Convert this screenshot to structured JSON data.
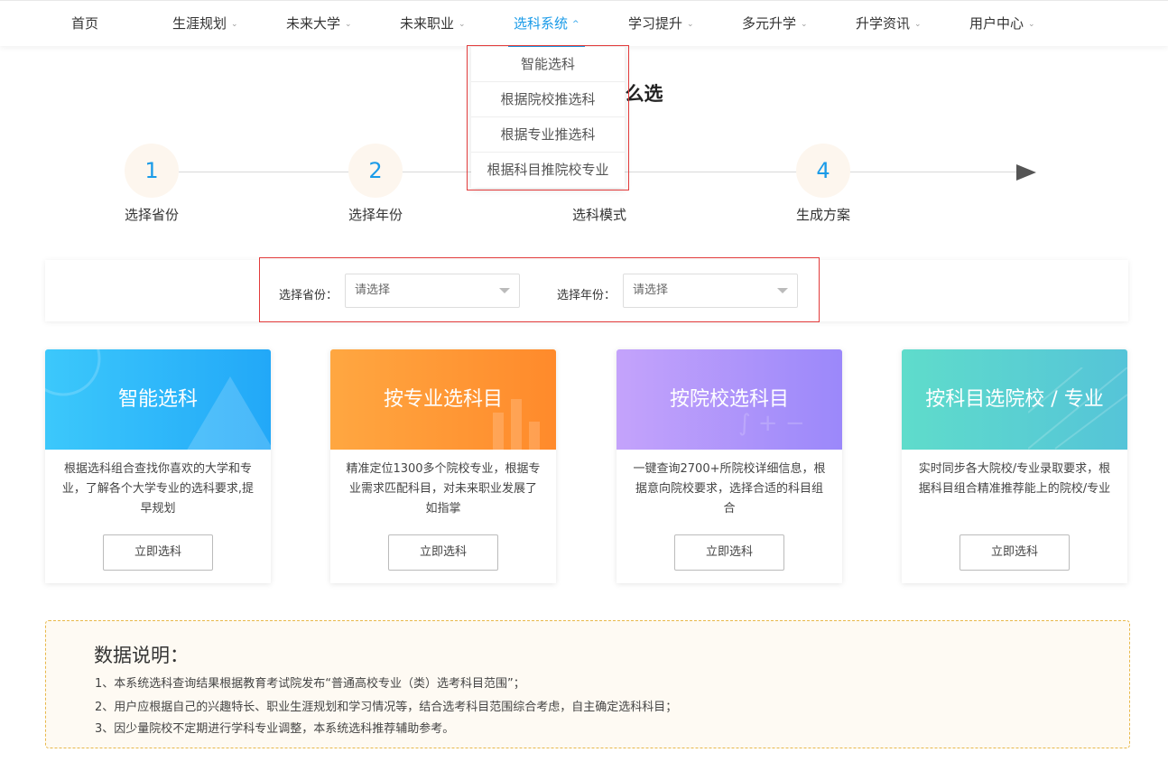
{
  "nav": {
    "items": [
      {
        "label": "首页",
        "has_chevron": false
      },
      {
        "label": "生涯规划",
        "has_chevron": true
      },
      {
        "label": "未来大学",
        "has_chevron": true
      },
      {
        "label": "未来职业",
        "has_chevron": true
      },
      {
        "label": "选科系统",
        "has_chevron": true,
        "active": true
      },
      {
        "label": "学习提升",
        "has_chevron": true
      },
      {
        "label": "多元升学",
        "has_chevron": true
      },
      {
        "label": "升学资讯",
        "has_chevron": true
      },
      {
        "label": "用户中心",
        "has_chevron": true
      }
    ],
    "chevron_down": "⌄",
    "chevron_up": "^"
  },
  "dropdown": {
    "items": [
      "智能选科",
      "根据院校推选科",
      "根据专业推选科",
      "根据科目推院校专业"
    ]
  },
  "heading": "么选",
  "steps": [
    {
      "number": "1",
      "label": "选择省份"
    },
    {
      "number": "2",
      "label": "选择年份"
    },
    {
      "number": "",
      "label": "选科模式"
    },
    {
      "number": "4",
      "label": "生成方案"
    }
  ],
  "selectors": {
    "province_label": "选择省份：",
    "province_value": "请选择",
    "year_label": "选择年份：",
    "year_value": "请选择"
  },
  "cards": [
    {
      "title": "智能选科",
      "desc": "根据选科组合查找你喜欢的大学和专业，了解各个大学专业的选科要求,提早规划",
      "button": "立即选科"
    },
    {
      "title": "按专业选科目",
      "desc": "精准定位1300多个院校专业，根据专业需求匹配科目，对未来职业发展了如指掌",
      "button": "立即选科"
    },
    {
      "title": "按院校选科目",
      "desc": "一键查询2700+所院校详细信息，根据意向院校要求，选择合适的科目组合",
      "button": "立即选科"
    },
    {
      "title": "按科目选院校 / 专业",
      "desc": "实时同步各大院校/专业录取要求，根据科目组合精准推荐能上的院校/专业",
      "button": "立即选科"
    }
  ],
  "notes": {
    "title": "数据说明：",
    "lines": [
      "1、本系统选科查询结果根据教育考试院发布“普通高校专业（类）选考科目范围”；",
      "2、用户应根据自己的兴趣特长、职业生涯规划和学习情况等，结合选考科目范围综合考虑，自主确定选科科目；",
      "3、因少量院校不定期进行学科专业调整，本系统选科推荐辅助参考。"
    ]
  },
  "colors": {
    "accent": "#1a9be8",
    "highlight_outline": "#e23b3b",
    "card1": [
      "#3cc8fb",
      "#22a8f8"
    ],
    "card2": [
      "#ffa741",
      "#ff8a2b"
    ],
    "card3": [
      "#c4a3fb",
      "#9b88fa"
    ],
    "card4": [
      "#5fdccb",
      "#55c4d8"
    ]
  }
}
